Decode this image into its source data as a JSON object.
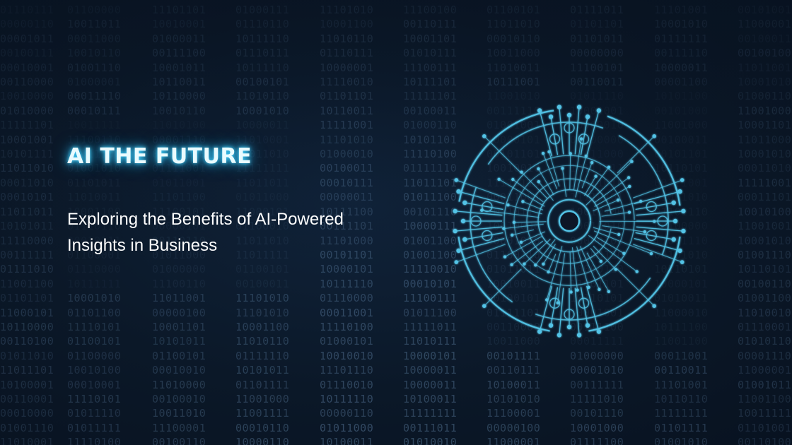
{
  "hero": {
    "headline": "AI THE FUTURE",
    "subtitle_lines": [
      "Exploring the Benefits of AI-Powered",
      "Insights in Business"
    ]
  },
  "colors": {
    "background": "#0b1828",
    "headline_glow": "#46d4ff",
    "circuit": "#52c3e6",
    "subtitle": "#ffffff"
  },
  "emblem": {
    "name": "circuit-ring-icon"
  }
}
